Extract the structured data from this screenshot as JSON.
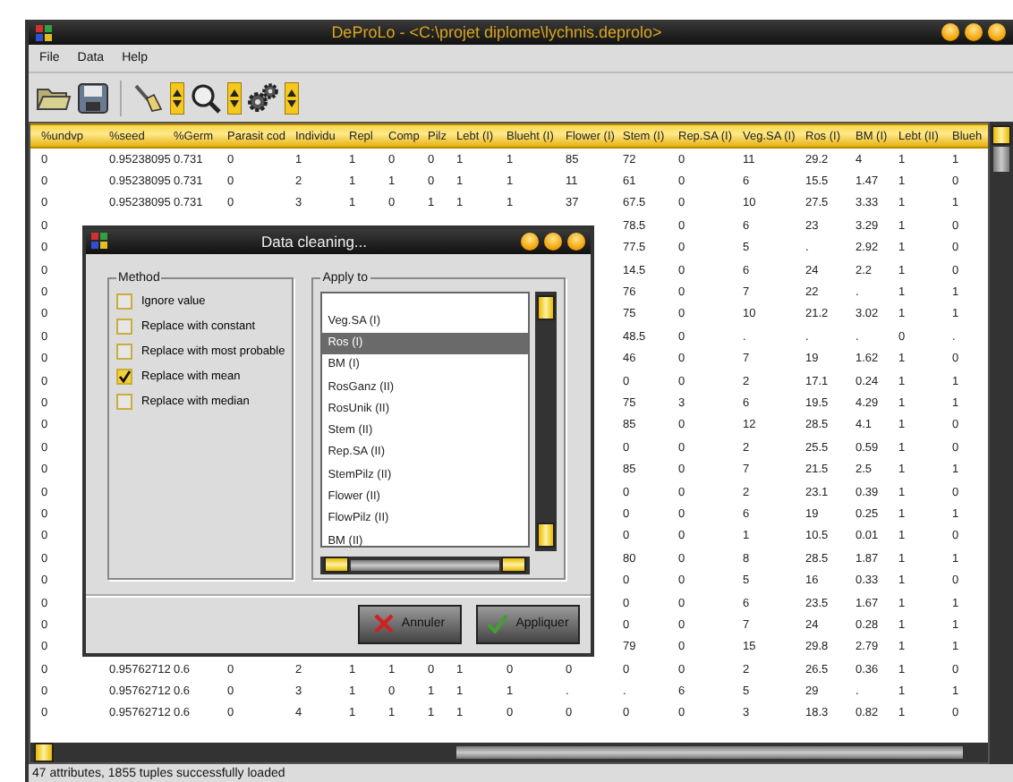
{
  "window": {
    "title": "DeProLo - <C:\\projet diplome\\lychnis.deprolo>"
  },
  "menu": [
    "File",
    "Data",
    "Help"
  ],
  "table": {
    "columns": [
      "%undvp",
      "%seed",
      "%Germ",
      "Parasit cod",
      "Individu",
      "Repl",
      "Comp",
      "Pilz",
      "Lebt (I)",
      "Blueht (I)",
      "Flower (I)",
      "Stem (I)",
      "Rep.SA (I)",
      "Veg.SA (I)",
      "Ros (I)",
      "BM (I)",
      "Lebt (II)",
      "Blueh"
    ],
    "rows": [
      [
        "0",
        "0.95238095",
        "0.731",
        "0",
        "1",
        "1",
        "0",
        "0",
        "1",
        "1",
        "85",
        "72",
        "0",
        "11",
        "29.2",
        "4",
        "1",
        "1"
      ],
      [
        "0",
        "0.95238095",
        "0.731",
        "0",
        "2",
        "1",
        "1",
        "0",
        "1",
        "1",
        "11",
        "61",
        "0",
        "6",
        "15.5",
        "1.47",
        "1",
        "0"
      ],
      [
        "0",
        "0.95238095",
        "0.731",
        "0",
        "3",
        "1",
        "0",
        "1",
        "1",
        "1",
        "37",
        "67.5",
        "0",
        "10",
        "27.5",
        "3.33",
        "1",
        "1"
      ],
      [
        "0",
        null,
        null,
        null,
        null,
        null,
        null,
        null,
        null,
        null,
        null,
        "78.5",
        "0",
        "6",
        "23",
        "3.29",
        "1",
        "0"
      ],
      [
        "0",
        null,
        null,
        null,
        null,
        null,
        null,
        null,
        null,
        null,
        null,
        "77.5",
        "0",
        "5",
        ".",
        "2.92",
        "1",
        "0"
      ],
      [
        "0",
        null,
        null,
        null,
        null,
        null,
        null,
        null,
        null,
        null,
        null,
        "14.5",
        "0",
        "6",
        "24",
        "2.2",
        "1",
        "0"
      ],
      [
        "0",
        null,
        null,
        null,
        null,
        null,
        null,
        null,
        null,
        null,
        null,
        "76",
        "0",
        "7",
        "22",
        ".",
        "1",
        "1"
      ],
      [
        "0",
        null,
        null,
        null,
        null,
        null,
        null,
        null,
        null,
        null,
        null,
        "75",
        "0",
        "10",
        "21.2",
        "3.02",
        "1",
        "1"
      ],
      [
        "0",
        null,
        null,
        null,
        null,
        null,
        null,
        null,
        null,
        null,
        null,
        "48.5",
        "0",
        ".",
        ".",
        ".",
        "0",
        "."
      ],
      [
        "0",
        null,
        null,
        null,
        null,
        null,
        null,
        null,
        null,
        null,
        null,
        "46",
        "0",
        "7",
        "19",
        "1.62",
        "1",
        "0"
      ],
      [
        "0",
        null,
        null,
        null,
        null,
        null,
        null,
        null,
        null,
        null,
        null,
        "0",
        "0",
        "2",
        "17.1",
        "0.24",
        "1",
        "1"
      ],
      [
        "0",
        null,
        null,
        null,
        null,
        null,
        null,
        null,
        null,
        null,
        null,
        "75",
        "3",
        "6",
        "19.5",
        "4.29",
        "1",
        "1"
      ],
      [
        "0",
        null,
        null,
        null,
        null,
        null,
        null,
        null,
        null,
        null,
        null,
        "85",
        "0",
        "12",
        "28.5",
        "4.1",
        "1",
        "0"
      ],
      [
        "0",
        null,
        null,
        null,
        null,
        null,
        null,
        null,
        null,
        null,
        null,
        "0",
        "0",
        "2",
        "25.5",
        "0.59",
        "1",
        "0"
      ],
      [
        "0",
        null,
        null,
        null,
        null,
        null,
        null,
        null,
        null,
        null,
        null,
        "85",
        "0",
        "7",
        "21.5",
        "2.5",
        "1",
        "1"
      ],
      [
        "0",
        null,
        null,
        null,
        null,
        null,
        null,
        null,
        null,
        null,
        null,
        "0",
        "0",
        "2",
        "23.1",
        "0.39",
        "1",
        "0"
      ],
      [
        "0",
        null,
        null,
        null,
        null,
        null,
        null,
        null,
        null,
        null,
        null,
        "0",
        "0",
        "6",
        "19",
        "0.25",
        "1",
        "1"
      ],
      [
        "0",
        null,
        null,
        null,
        null,
        null,
        null,
        null,
        null,
        null,
        null,
        "0",
        "0",
        "1",
        "10.5",
        "0.01",
        "1",
        "0"
      ],
      [
        "0",
        null,
        null,
        null,
        null,
        null,
        null,
        null,
        null,
        null,
        null,
        "80",
        "0",
        "8",
        "28.5",
        "1.87",
        "1",
        "1"
      ],
      [
        "0",
        null,
        null,
        null,
        null,
        null,
        null,
        null,
        null,
        null,
        null,
        "0",
        "0",
        "5",
        "16",
        "0.33",
        "1",
        "0"
      ],
      [
        "0",
        null,
        null,
        null,
        null,
        null,
        null,
        null,
        null,
        null,
        null,
        "0",
        "0",
        "6",
        "23.5",
        "1.67",
        "1",
        "1"
      ],
      [
        "0",
        null,
        null,
        null,
        null,
        null,
        null,
        null,
        null,
        null,
        null,
        "0",
        "0",
        "7",
        "24",
        "0.28",
        "1",
        "1"
      ],
      [
        "0",
        null,
        null,
        null,
        null,
        null,
        null,
        null,
        null,
        null,
        null,
        "79",
        "0",
        "15",
        "29.8",
        "2.79",
        "1",
        "1"
      ],
      [
        "0",
        "0.95762712",
        "0.6",
        "0",
        "2",
        "1",
        "1",
        "0",
        "1",
        "0",
        "0",
        "0",
        "0",
        "2",
        "26.5",
        "0.36",
        "1",
        "0"
      ],
      [
        "0",
        "0.95762712",
        "0.6",
        "0",
        "3",
        "1",
        "0",
        "1",
        "1",
        "1",
        ".",
        ".",
        "6",
        "5",
        "29",
        ".",
        "1",
        "1"
      ],
      [
        "0",
        "0.95762712",
        "0.6",
        "0",
        "4",
        "1",
        "1",
        "1",
        "1",
        "0",
        "0",
        "0",
        "0",
        "3",
        "18.3",
        "0.82",
        "1",
        "0"
      ]
    ]
  },
  "status_bar": "47 attributes, 1855 tuples successfully loaded",
  "dialog": {
    "title": "Data cleaning...",
    "method": {
      "legend": "Method",
      "options": [
        {
          "label": "Ignore value",
          "checked": false
        },
        {
          "label": "Replace with constant",
          "checked": false
        },
        {
          "label": "Replace with most probable",
          "checked": false
        },
        {
          "label": "Replace with mean",
          "checked": true
        },
        {
          "label": "Replace with median",
          "checked": false
        }
      ]
    },
    "apply_to": {
      "legend": "Apply to",
      "items": [
        {
          "label": "Veg.SA (I)",
          "selected": false
        },
        {
          "label": "Ros (I)",
          "selected": true
        },
        {
          "label": "BM (I)",
          "selected": false
        },
        {
          "label": "RosGanz (II)",
          "selected": false
        },
        {
          "label": "RosUnik (II)",
          "selected": false
        },
        {
          "label": "Stem (II)",
          "selected": false
        },
        {
          "label": "Rep.SA (II)",
          "selected": false
        },
        {
          "label": "StemPilz (II)",
          "selected": false
        },
        {
          "label": "Flower (II)",
          "selected": false
        },
        {
          "label": "FlowPilz (II)",
          "selected": false
        },
        {
          "label": "BM (II)",
          "selected": false
        }
      ]
    },
    "buttons": [
      {
        "label": "Annuler",
        "kind": "cancel"
      },
      {
        "label": "Appliquer",
        "kind": "apply"
      }
    ]
  }
}
